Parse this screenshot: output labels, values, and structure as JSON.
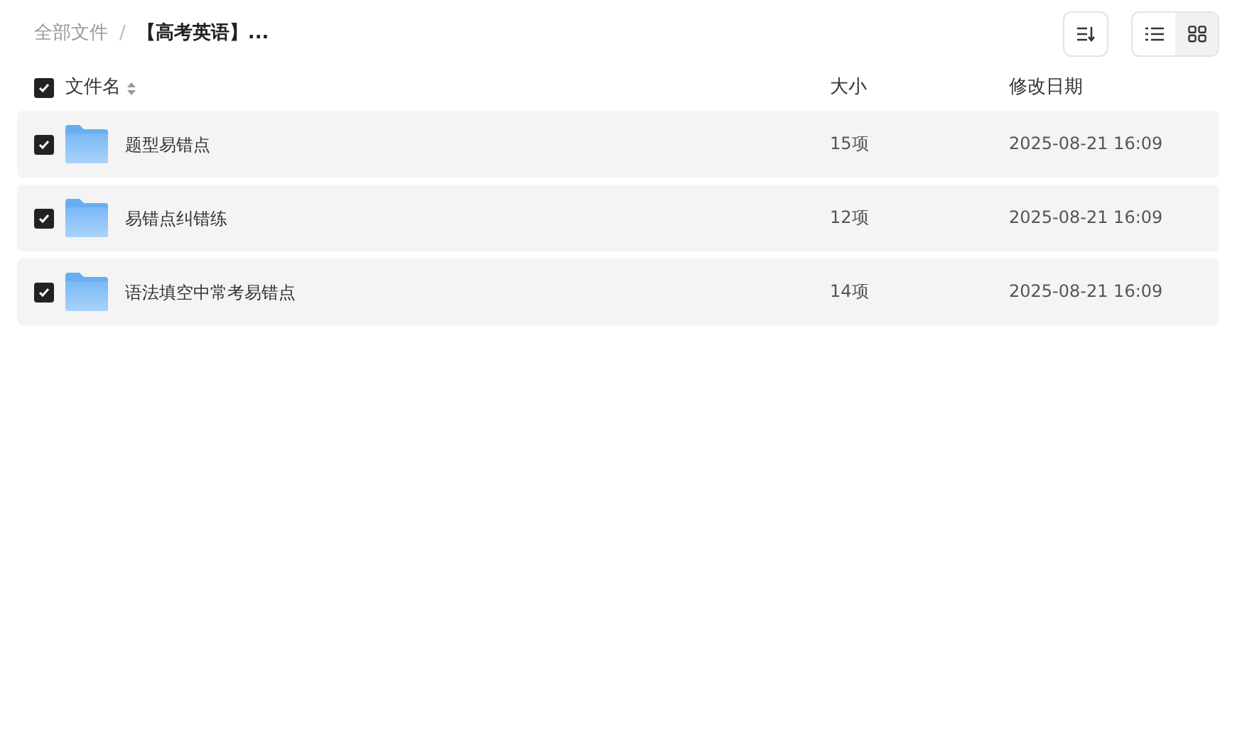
{
  "breadcrumb": [
    {
      "label": "全部文件",
      "current": false
    },
    {
      "separator": "/"
    },
    {
      "label": "【高考英语】..."
    }
  ],
  "toolbar": {
    "views": [
      {
        "kind": "list",
        "selected": false
      },
      {
        "kind": "grid",
        "selected": true
      }
    ]
  },
  "header": {
    "checked": true,
    "columns": [
      "文件名",
      "大小",
      "修改日期"
    ]
  },
  "rows": [
    {
      "checked": true,
      "name": "题型易错点",
      "size": "15项",
      "modified": "2025-08-21 16:09"
    },
    {
      "checked": true,
      "name": "易错点纠错练",
      "size": "12项",
      "modified": "2025-08-21 16:09"
    },
    {
      "checked": true,
      "name": "语法填空中常考易错点",
      "size": "14项",
      "modified": "2025-08-21 16:09"
    }
  ]
}
